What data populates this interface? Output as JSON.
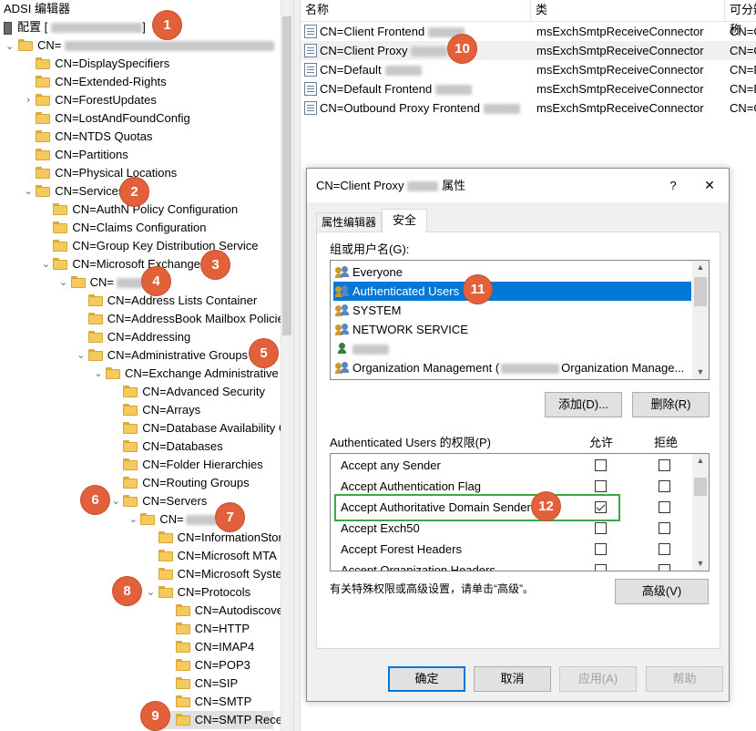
{
  "app": {
    "title": "ADSI 编辑器",
    "root_label": "配置"
  },
  "tree": {
    "top": "CN=",
    "items": [
      {
        "label": "CN=DisplaySpecifiers",
        "level": 1,
        "toggle": ""
      },
      {
        "label": "CN=Extended-Rights",
        "level": 1,
        "toggle": ""
      },
      {
        "label": "CN=ForestUpdates",
        "level": 1,
        "toggle": "collapsed"
      },
      {
        "label": "CN=LostAndFoundConfig",
        "level": 1,
        "toggle": ""
      },
      {
        "label": "CN=NTDS Quotas",
        "level": 1,
        "toggle": ""
      },
      {
        "label": "CN=Partitions",
        "level": 1,
        "toggle": ""
      },
      {
        "label": "CN=Physical Locations",
        "level": 1,
        "toggle": ""
      },
      {
        "label": "CN=Services",
        "level": 1,
        "toggle": "expanded"
      },
      {
        "label": "CN=AuthN Policy Configuration",
        "level": 2,
        "toggle": ""
      },
      {
        "label": "CN=Claims Configuration",
        "level": 2,
        "toggle": ""
      },
      {
        "label": "CN=Group Key Distribution Service",
        "level": 2,
        "toggle": ""
      },
      {
        "label": "CN=Microsoft Exchange",
        "level": 2,
        "toggle": "expanded"
      },
      {
        "label": "CN=",
        "level": 3,
        "toggle": "expanded",
        "blur": true
      },
      {
        "label": "CN=Address Lists Container",
        "level": 4,
        "toggle": ""
      },
      {
        "label": "CN=AddressBook Mailbox Policies",
        "level": 4,
        "toggle": ""
      },
      {
        "label": "CN=Addressing",
        "level": 4,
        "toggle": ""
      },
      {
        "label": "CN=Administrative Groups",
        "level": 4,
        "toggle": "expanded"
      },
      {
        "label": "CN=Exchange Administrative Group",
        "level": 5,
        "toggle": "expanded"
      },
      {
        "label": "CN=Advanced Security",
        "level": 6,
        "toggle": ""
      },
      {
        "label": "CN=Arrays",
        "level": 6,
        "toggle": ""
      },
      {
        "label": "CN=Database Availability Groups",
        "level": 6,
        "toggle": ""
      },
      {
        "label": "CN=Databases",
        "level": 6,
        "toggle": ""
      },
      {
        "label": "CN=Folder Hierarchies",
        "level": 6,
        "toggle": ""
      },
      {
        "label": "CN=Routing Groups",
        "level": 6,
        "toggle": ""
      },
      {
        "label": "CN=Servers",
        "level": 6,
        "toggle": "expanded"
      },
      {
        "label": "CN=",
        "level": 7,
        "toggle": "expanded",
        "blur": true
      },
      {
        "label": "CN=InformationStore",
        "level": 8,
        "toggle": ""
      },
      {
        "label": "CN=Microsoft MTA",
        "level": 8,
        "toggle": ""
      },
      {
        "label": "CN=Microsoft System Attendant",
        "level": 8,
        "toggle": ""
      },
      {
        "label": "CN=Protocols",
        "level": 8,
        "toggle": "expanded"
      },
      {
        "label": "CN=Autodiscover",
        "level": 9,
        "toggle": ""
      },
      {
        "label": "CN=HTTP",
        "level": 9,
        "toggle": ""
      },
      {
        "label": "CN=IMAP4",
        "level": 9,
        "toggle": ""
      },
      {
        "label": "CN=POP3",
        "level": 9,
        "toggle": ""
      },
      {
        "label": "CN=SIP",
        "level": 9,
        "toggle": ""
      },
      {
        "label": "CN=SMTP",
        "level": 9,
        "toggle": ""
      },
      {
        "label": "CN=SMTP Receive Connectors",
        "level": 9,
        "toggle": "",
        "selected": true
      }
    ]
  },
  "list": {
    "columns": [
      "名称",
      "类",
      "可分辨名称"
    ],
    "rows": [
      {
        "name": "CN=Client Frontend",
        "class": "msExchSmtpReceiveConnector",
        "dn": "CN=C"
      },
      {
        "name": "CN=Client Proxy",
        "class": "msExchSmtpReceiveConnector",
        "dn": "CN=C",
        "selected": true
      },
      {
        "name": "CN=Default",
        "class": "msExchSmtpReceiveConnector",
        "dn": "CN=D"
      },
      {
        "name": "CN=Default Frontend",
        "class": "msExchSmtpReceiveConnector",
        "dn": "CN=D"
      },
      {
        "name": "CN=Outbound Proxy Frontend",
        "class": "msExchSmtpReceiveConnector",
        "dn": "CN=O"
      }
    ]
  },
  "dialog": {
    "title_prefix": "CN=Client Proxy",
    "title_suffix": "属性",
    "help": "?",
    "close": "✕",
    "tabs": [
      "属性编辑器",
      "安全"
    ],
    "users_label": "组或用户名(G):",
    "users": [
      {
        "name": "Everyone",
        "icon": "group-icon"
      },
      {
        "name": "Authenticated Users",
        "icon": "group-icon",
        "selected": true
      },
      {
        "name": "SYSTEM",
        "icon": "group-icon"
      },
      {
        "name": "NETWORK SERVICE",
        "icon": "group-icon"
      },
      {
        "name": "",
        "icon": "user-icon",
        "blur": true
      },
      {
        "name": "Organization Management (",
        "name2": "Organization Manage...",
        "icon": "group-icon"
      }
    ],
    "add_label": "添加(D)...",
    "remove_label": "删除(R)",
    "perm_label": "Authenticated Users 的权限(P)",
    "allow_label": "允许",
    "deny_label": "拒绝",
    "perms": [
      {
        "name": "Accept any Sender",
        "allow": false,
        "deny": false
      },
      {
        "name": "Accept Authentication Flag",
        "allow": false,
        "deny": false
      },
      {
        "name": "Accept Authoritative Domain Sender",
        "allow": true,
        "deny": false,
        "highlight": true
      },
      {
        "name": "Accept Exch50",
        "allow": false,
        "deny": false
      },
      {
        "name": "Accept Forest Headers",
        "allow": false,
        "deny": false
      },
      {
        "name": "Accept Organization Headers",
        "allow": false,
        "deny": false
      }
    ],
    "advanced_hint": "有关特殊权限或高级设置，请单击“高级”。",
    "advanced_label": "高级(V)",
    "ok_label": "确定",
    "cancel_label": "取消",
    "apply_label": "应用(A)",
    "help_label": "帮助"
  },
  "badges": [
    "1",
    "2",
    "3",
    "4",
    "5",
    "6",
    "7",
    "8",
    "9",
    "10",
    "11",
    "12"
  ],
  "colors": {
    "badge": "#e2603a",
    "selection": "#0078d7",
    "highlight_box": "#3aa845",
    "folder": "#f4c95d"
  }
}
